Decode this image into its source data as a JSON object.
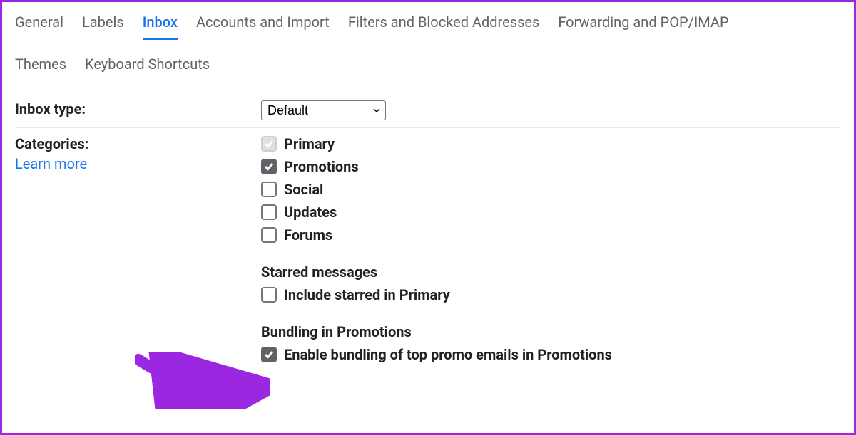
{
  "tabs": {
    "row1": [
      "General",
      "Labels",
      "Inbox",
      "Accounts and Import",
      "Filters and Blocked Addresses",
      "Forwarding and POP/IMAP"
    ],
    "row2": [
      "Themes",
      "Keyboard Shortcuts"
    ],
    "active": "Inbox"
  },
  "inboxType": {
    "label": "Inbox type:",
    "value": "Default"
  },
  "categories": {
    "label": "Categories:",
    "learnMore": "Learn more",
    "items": [
      {
        "label": "Primary",
        "checked": true,
        "disabled": true
      },
      {
        "label": "Promotions",
        "checked": true,
        "disabled": false
      },
      {
        "label": "Social",
        "checked": false,
        "disabled": false
      },
      {
        "label": "Updates",
        "checked": false,
        "disabled": false
      },
      {
        "label": "Forums",
        "checked": false,
        "disabled": false
      }
    ],
    "starred": {
      "heading": "Starred messages",
      "label": "Include starred in Primary",
      "checked": false
    },
    "bundling": {
      "heading": "Bundling in Promotions",
      "label": "Enable bundling of top promo emails in Promotions",
      "checked": true
    }
  }
}
